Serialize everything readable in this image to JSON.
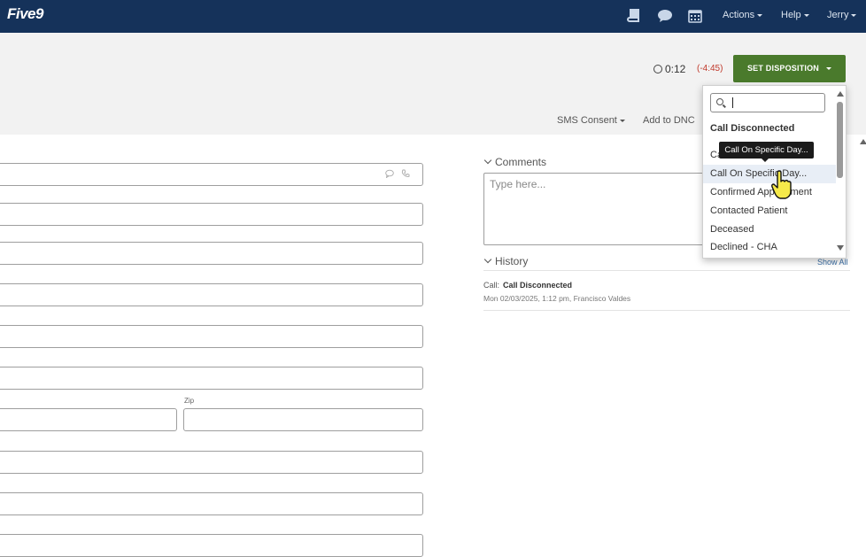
{
  "navbar": {
    "logo": "Five9",
    "icons": [
      "book-icon",
      "chat-icon",
      "calendar-icon"
    ],
    "menus": [
      {
        "label": "Actions"
      },
      {
        "label": "Help"
      },
      {
        "label": "Jerry"
      }
    ]
  },
  "call": {
    "elapsed": "0:12",
    "remaining": "(-4:45)",
    "set_disposition_label": "SET DISPOSITION"
  },
  "links": {
    "sms_consent": "SMS Consent",
    "add_to_dnc": "Add to DNC"
  },
  "form": {
    "zip_label": "Zip"
  },
  "comments": {
    "title": "Comments",
    "placeholder": "Type here..."
  },
  "history": {
    "title": "History",
    "show_all": "Show All",
    "entries": [
      {
        "type": "Call:",
        "disposition": "Call Disconnected",
        "detail": "Mon 02/03/2025, 1:12 pm, Francisco Valdes"
      }
    ]
  },
  "disposition_dropdown": {
    "search_value": "",
    "items": [
      {
        "label": "Call Disconnected",
        "header": true
      },
      {
        "label": "Ca"
      },
      {
        "label": "Call On Specific Day..."
      },
      {
        "label": "Confirmed Appointment"
      },
      {
        "label": "Contacted Patient"
      },
      {
        "label": "Deceased"
      },
      {
        "label": "Declined - CHA"
      }
    ],
    "tooltip": "Call On Specific Day..."
  },
  "colors": {
    "navbar": "#15325a",
    "disposition_button": "#4a7a2c",
    "timer_remaining": "#c0392b",
    "link": "#3a6ea5"
  }
}
